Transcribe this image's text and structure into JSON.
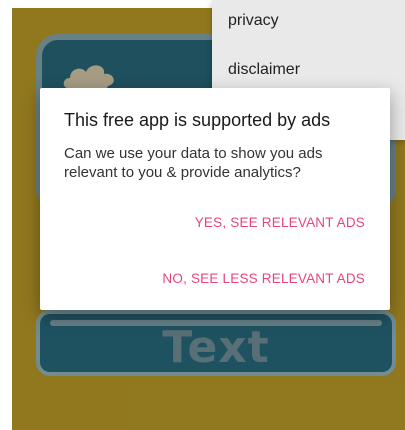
{
  "background": {
    "app_color": "#c9a72a",
    "text_panel_label": "Text"
  },
  "menu": {
    "items": [
      {
        "label": "privacy"
      },
      {
        "label": "disclaimer"
      }
    ]
  },
  "dialog": {
    "title": "This free app is supported by ads",
    "body": "Can we use your data to show you ads relevant to you & provide analytics?",
    "accept_label": "YES, SEE RELEVANT ADS",
    "decline_label": "NO, SEE LESS RELEVANT ADS",
    "button_color": "#e8457a"
  }
}
